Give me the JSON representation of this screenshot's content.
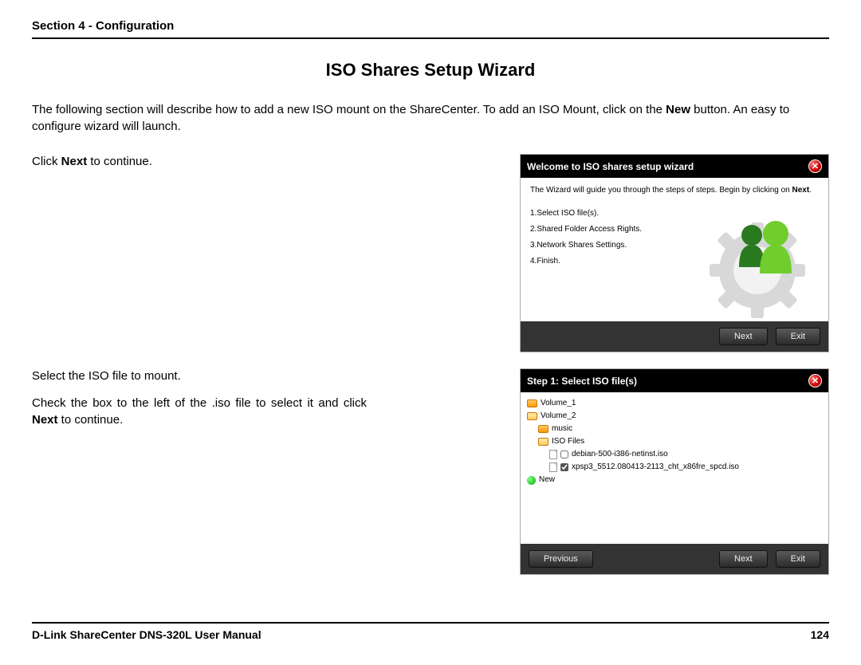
{
  "section_header": "Section 4 - Configuration",
  "page_title": "ISO Shares Setup Wizard",
  "intro_prefix": "The following section will describe how to add a new ISO mount on the ShareCenter. To add an ISO Mount, click on the ",
  "intro_bold": "New",
  "intro_suffix": " button. An easy to configure wizard will launch.",
  "block1": {
    "instruction_prefix": "Click ",
    "instruction_bold": "Next",
    "instruction_suffix": " to continue.",
    "wizard_title": "Welcome to ISO shares setup wizard",
    "wizard_intro": "The Wizard will guide you through the steps of steps. Begin by clicking on ",
    "wizard_intro_bold": "Next",
    "wizard_intro_suffix": ".",
    "steps": [
      "1.Select ISO file(s).",
      "2.Shared Folder Access Rights.",
      "3.Network Shares Settings.",
      "4.Finish."
    ],
    "btn_next": "Next",
    "btn_exit": "Exit"
  },
  "block2": {
    "instruction1": "Select the ISO file to mount.",
    "instruction2_prefix": "Check the box to the left of the .iso file to select it and click ",
    "instruction2_bold": "Next",
    "instruction2_suffix": " to continue.",
    "wizard_title": "Step 1: Select ISO file(s)",
    "tree": [
      {
        "label": "Volume_1",
        "type": "folder",
        "indent": 0
      },
      {
        "label": "Volume_2",
        "type": "folder-open",
        "indent": 0
      },
      {
        "label": "music",
        "type": "folder",
        "indent": 1
      },
      {
        "label": "ISO Files",
        "type": "folder-open",
        "indent": 1
      },
      {
        "label": "debian-500-i386-netinst.iso",
        "type": "file",
        "indent": 2,
        "checkbox": true,
        "checked": false
      },
      {
        "label": "xpsp3_5512.080413-2113_cht_x86fre_spcd.iso",
        "type": "file",
        "indent": 2,
        "checkbox": true,
        "checked": true
      },
      {
        "label": "New",
        "type": "new",
        "indent": 0
      }
    ],
    "btn_previous": "Previous",
    "btn_next": "Next",
    "btn_exit": "Exit"
  },
  "footer": {
    "manual": "D-Link ShareCenter DNS-320L User Manual",
    "page": "124"
  }
}
